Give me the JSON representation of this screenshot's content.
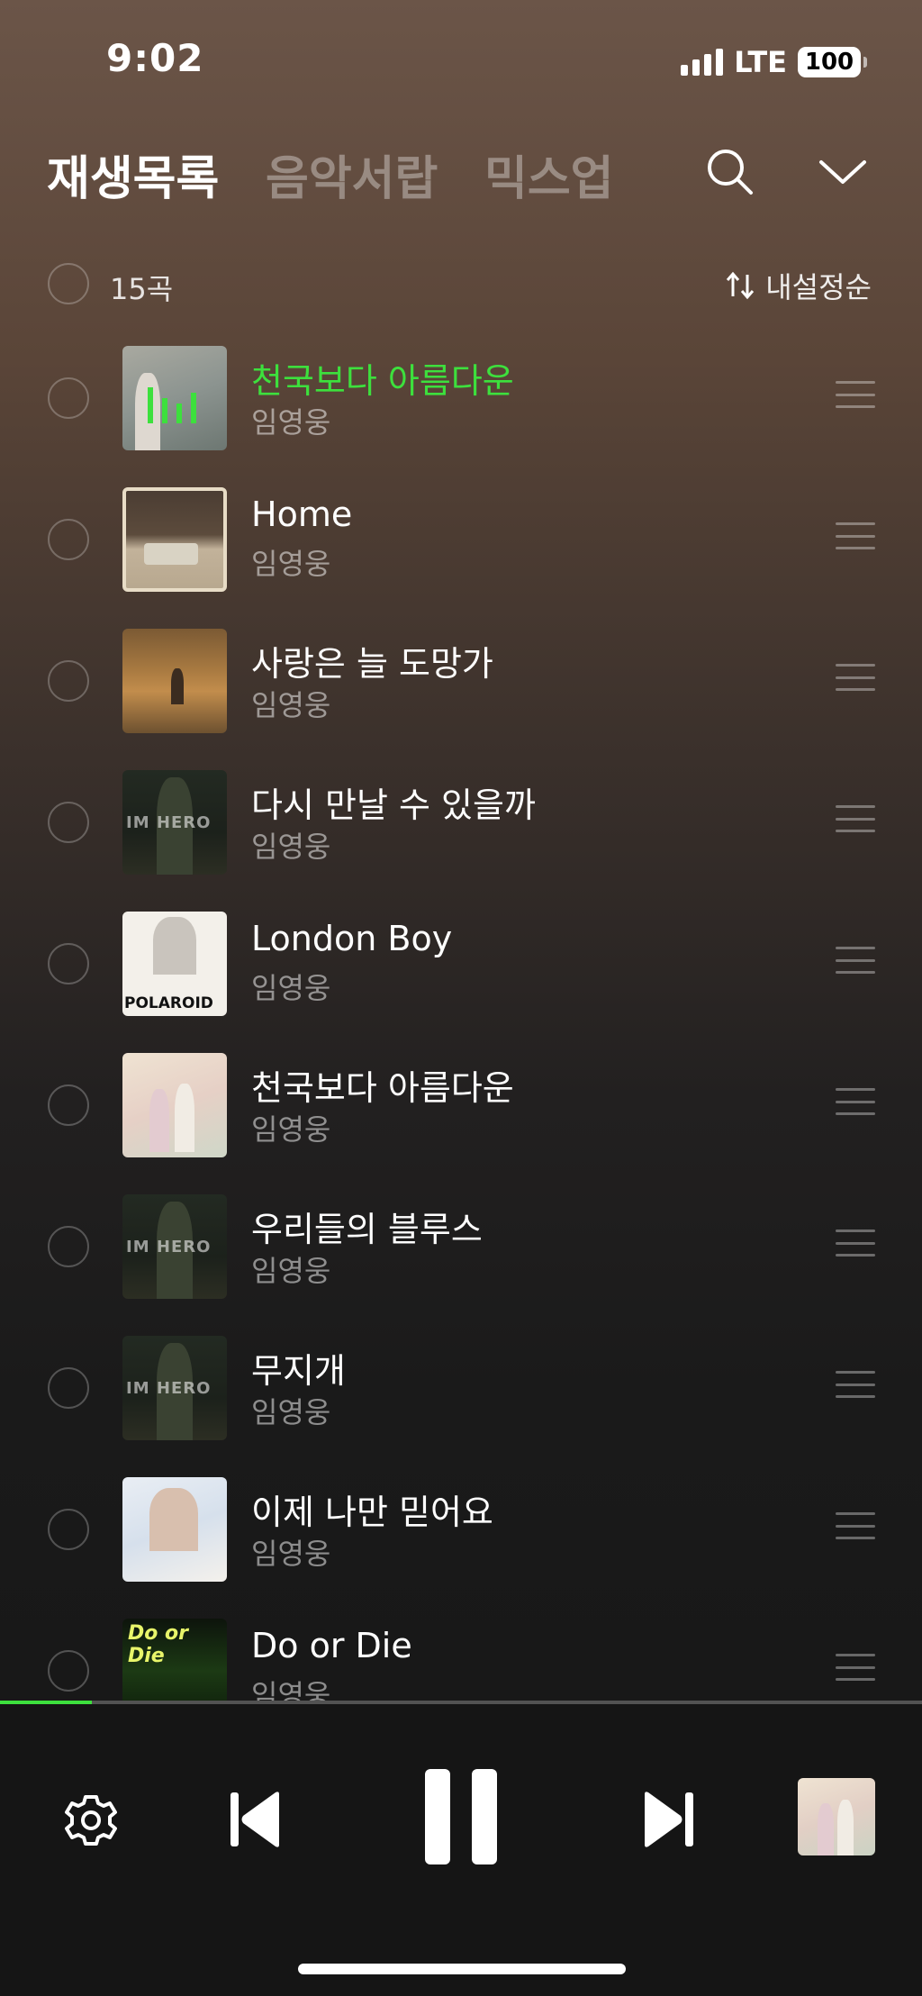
{
  "status_bar": {
    "time": "9:02",
    "network": "LTE",
    "battery": "100"
  },
  "header": {
    "tabs": [
      {
        "label": "재생목록",
        "active": true
      },
      {
        "label": "음악서랍",
        "active": false
      },
      {
        "label": "믹스업",
        "active": false
      }
    ],
    "icons": [
      "search-icon",
      "chevron-down-icon"
    ]
  },
  "list_meta": {
    "count": "15곡",
    "sort_label": "내설정순"
  },
  "tracks": [
    {
      "title": "천국보다 아름다운",
      "artist": "임영웅",
      "playing": true
    },
    {
      "title": "Home",
      "artist": "임영웅",
      "playing": false
    },
    {
      "title": "사랑은 늘 도망가",
      "artist": "임영웅",
      "playing": false
    },
    {
      "title": "다시 만날 수 있을까",
      "artist": "임영웅",
      "playing": false,
      "art_text": "IM HERO"
    },
    {
      "title": "London Boy",
      "artist": "임영웅",
      "playing": false,
      "art_text": "POLAROID"
    },
    {
      "title": "천국보다 아름다운",
      "artist": "임영웅",
      "playing": false
    },
    {
      "title": "우리들의 블루스",
      "artist": "임영웅",
      "playing": false,
      "art_text": "IM HERO"
    },
    {
      "title": "무지개",
      "artist": "임영웅",
      "playing": false,
      "art_text": "IM HERO"
    },
    {
      "title": "이제 나만 믿어요",
      "artist": "임영웅",
      "playing": false
    },
    {
      "title": "Do or Die",
      "artist": "임영웅",
      "playing": false,
      "art_text": "Do or Die"
    }
  ],
  "player": {
    "progress_fraction": 0.1,
    "controls": [
      "settings-icon",
      "previous-icon",
      "pause-icon",
      "next-icon"
    ],
    "accent_color": "#3de03d"
  }
}
